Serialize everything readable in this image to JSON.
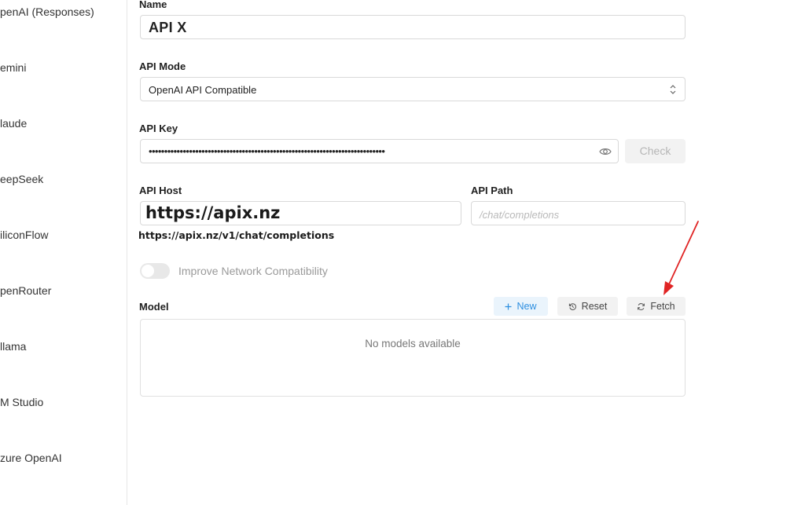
{
  "sidebar": {
    "items": [
      {
        "label": "penAI (Responses)"
      },
      {
        "label": "emini"
      },
      {
        "label": "laude"
      },
      {
        "label": "eepSeek"
      },
      {
        "label": "iliconFlow"
      },
      {
        "label": "penRouter"
      },
      {
        "label": "llama"
      },
      {
        "label": "M Studio"
      },
      {
        "label": "zure OpenAI"
      }
    ]
  },
  "form": {
    "name_label": "Name",
    "name_value": "API X",
    "mode_label": "API Mode",
    "mode_value": "OpenAI API Compatible",
    "key_label": "API Key",
    "key_value": "••••••••••••••••••••••••••••••••••••••••••••••••••••••••••••••••••••••••••••",
    "check_label": "Check",
    "host_label": "API Host",
    "host_value": "https://apix.nz",
    "path_label": "API Path",
    "path_placeholder": "/chat/completions",
    "full_url": "https://apix.nz/v1/chat/completions",
    "compat_label": "Improve Network Compatibility",
    "compat_enabled": false
  },
  "models": {
    "label": "Model",
    "new_label": "New",
    "reset_label": "Reset",
    "fetch_label": "Fetch",
    "empty_text": "No models available"
  },
  "icons": {
    "new": "plus-icon",
    "reset": "rotate-ccw-icon",
    "fetch": "refresh-icon",
    "key_visibility": "eye-icon",
    "mode_select": "chevron-up-down-icon"
  },
  "colors": {
    "accent": "#2d8fe0",
    "annotation_arrow": "#e02424"
  }
}
